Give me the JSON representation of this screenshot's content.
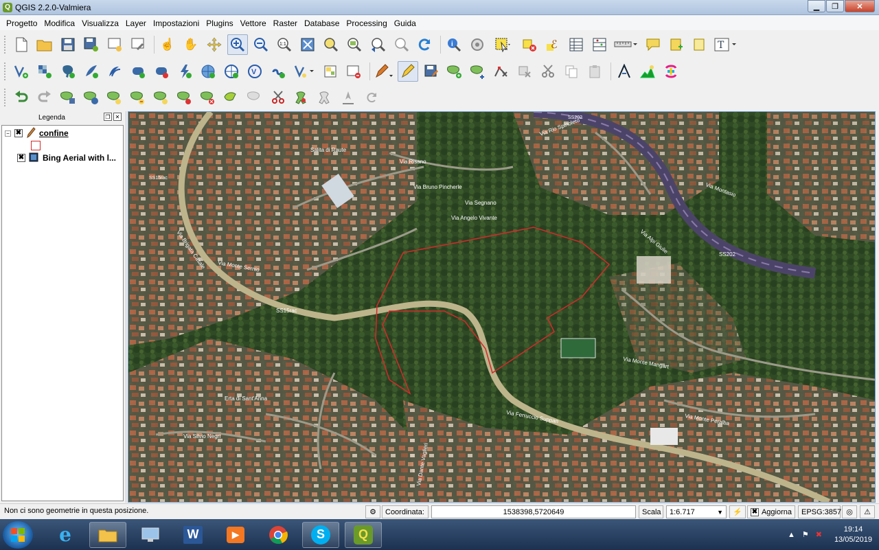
{
  "window": {
    "title": "QGIS 2.2.0-Valmiera"
  },
  "menu": [
    "Progetto",
    "Modifica",
    "Visualizza",
    "Layer",
    "Impostazioni",
    "Plugins",
    "Vettore",
    "Raster",
    "Database",
    "Processing",
    "Guida"
  ],
  "legend": {
    "title": "Legenda",
    "layers": [
      {
        "name": "confine",
        "checked": "✖"
      },
      {
        "name": "Bing Aerial with l...",
        "checked": "✖"
      }
    ]
  },
  "map": {
    "labels": [
      "Via Risano",
      "Via Bruno Pincherle",
      "Via Segnano",
      "Via Angelo Vivante",
      "Salita di Raute",
      "Via Rio Spinoleto",
      "Via Montasio",
      "Via Alpi Giulie",
      "Via Brigata Casale",
      "Via Monte Sernio",
      "Via Monte Mangart",
      "Via Ferruccio Suppan",
      "Via Monte Peralba",
      "Erta di Sant'Anna",
      "Via Silvio Negri",
      "Via Dante Vaglieri",
      "SS202",
      "SS15rac"
    ],
    "boundary_color": "#d42a2a"
  },
  "status": {
    "message": "Non ci sono geometrie in questa posizione.",
    "coord_label": "Coordinata:",
    "coord_value": "1538398,5720649",
    "scale_label": "Scala",
    "scale_value": "1:6.717",
    "render_label": "Aggiorna",
    "render_checked": "✖",
    "crs": "EPSG:3857"
  },
  "taskbar": {
    "time": "19:14",
    "date": "13/05/2019"
  }
}
